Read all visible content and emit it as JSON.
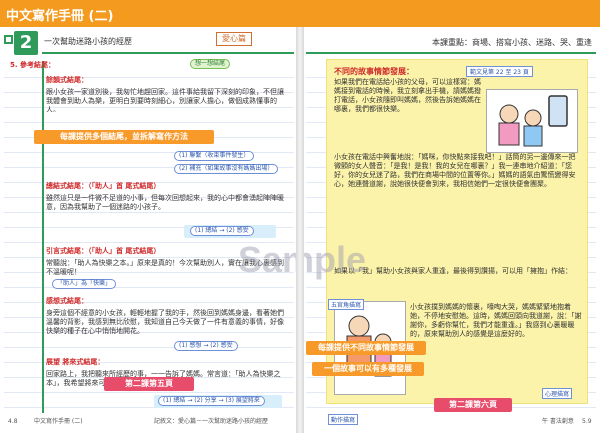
{
  "header": {
    "title": "中文寫作手冊 (二)"
  },
  "watermark": "Sample",
  "left": {
    "unit_number": "2",
    "unit_title": "一次幫助迷路小孩的經歷",
    "tag": "愛心篇",
    "section_heading": "5. 參考結尾：",
    "think_label": "想一想結尾",
    "callout_1": "每課提供多個結尾，並拆解寫作方法",
    "callout_2": "第二課第五頁",
    "endings": [
      {
        "label": "餘韻式結尾：",
        "text": "跟小女孩一家道別後，我匆忙地趕回家。這件事給我留下深刻的印象，不但讓我體會到助人為樂，更明白到要時刻細心，別讓家人擔心，做個成熟懂事的人。",
        "notes": [
          "(1) 聯繫（收束事件發生）",
          "(2) 補充（如果故事沒有媽媽出場）"
        ]
      },
      {
        "label": "總結式結尾：（「助人」首 尾式結尾）",
        "text": "雖然這只是一件微不足道的小事，但每次回想起來，我的心中都會湧起陣陣暖意，因為我幫助了一個迷路的小孩子。",
        "notes": [
          "(1) 總結 → (2) 感受"
        ]
      },
      {
        "label": "引言式結尾：（「助人」首 尾式結尾）",
        "text": "常聽說：「助人為快樂之本。」原來是真的！今次幫助別人，實在讓我心裏感到不溫暖呢！",
        "notes": [
          "「助人」為「快樂」"
        ]
      },
      {
        "label": "感想式結尾：",
        "text": "身旁這個不經意的小女孩，輕輕地握了我的手，然後回到媽媽身邊，看著她們溫馨的背影，我感到無比欣慰，我知道自己今天做了一件有意義的事情，好像快樂的種子在心中悄悄地開花。",
        "notes": [
          "(1) 感想 → (2) 感受"
        ]
      },
      {
        "label": "展望 將來式結尾：",
        "text": "回家路上，我把聽來所經歷的事，一一告訴了媽媽。常言道：「助人為快樂之本」，我希望將來可以幫助更多有需要的人。",
        "notes": [
          "(1) 總結 → (2) 分享 → (3) 展望將來"
        ]
      }
    ],
    "footer": {
      "page": "4.8",
      "book": "中文寫作手冊 (二)",
      "topic": "記敘文：愛心篇－一次幫助迷路小孩的經歷"
    }
  },
  "right": {
    "key_points": "本課重點：商場、搭寫小孩、迷路、哭、重逢",
    "box_title": "不同的故事情節發展：",
    "box_tag": "範文見第 22 至 23 頁",
    "para_1": "如果我們在電話給小孩的父母，可以這樣寫：媽媽接到電話的時候，我立刻拿出手機，請媽媽撥打電話，小女孩隨即叫媽媽，然後告訴她媽媽在哪裏，我們都很快樂。",
    "para_2": "小女孩在電話中興奮地說：「媽咪，你快點來接我吧！」話筒的另一邊傳來一把微顫的女人聲音：「是我！是我！我的女兒在哪裏？」我一連串地介紹道：「您好，你的女兒迷了路，我們在商場中間的位置等你。」媽媽的語氣由驚慌變得安心，她連聲道謝，說她很快便會到來，我相信她們一定很快便會團聚。",
    "para_3": "如果以「我」幫助小女孩與家人重逢，最後得到讚揚，可以用「擁抱」作結：",
    "para_4": "小女孩撲到媽媽的懷裏，嚎啕大哭，媽媽緊緊地抱着她，不停地安慰她。這時，媽媽回頭向我道謝，說：「謝謝你，多虧你幫忙，我們才能重逢。」我感到心裏暖暖的，原來幫助別人的感覺是這麼好的。",
    "annotations": [
      "五官角描寫",
      "動作描寫",
      "心理描寫"
    ],
    "callout_1": "每課提供不同故事情節發展",
    "callout_2": "一個故事可以有多種發展",
    "callout_3": "第二課第六頁",
    "footer": {
      "brand": "午 書法創意",
      "page": "5.9"
    }
  }
}
